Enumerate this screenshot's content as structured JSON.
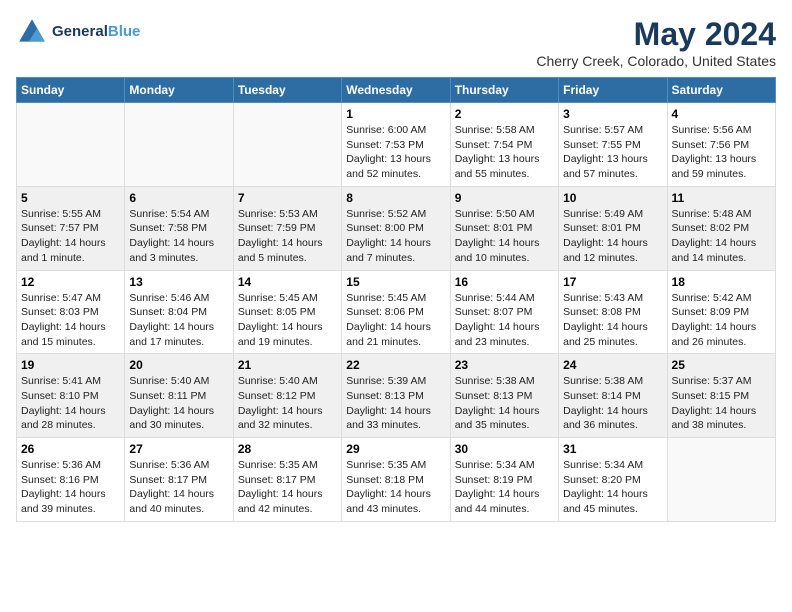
{
  "header": {
    "logo_line1": "General",
    "logo_line2": "Blue",
    "title": "May 2024",
    "subtitle": "Cherry Creek, Colorado, United States"
  },
  "weekdays": [
    "Sunday",
    "Monday",
    "Tuesday",
    "Wednesday",
    "Thursday",
    "Friday",
    "Saturday"
  ],
  "weeks": [
    [
      {
        "day": "",
        "info": ""
      },
      {
        "day": "",
        "info": ""
      },
      {
        "day": "",
        "info": ""
      },
      {
        "day": "1",
        "info": "Sunrise: 6:00 AM\nSunset: 7:53 PM\nDaylight: 13 hours\nand 52 minutes."
      },
      {
        "day": "2",
        "info": "Sunrise: 5:58 AM\nSunset: 7:54 PM\nDaylight: 13 hours\nand 55 minutes."
      },
      {
        "day": "3",
        "info": "Sunrise: 5:57 AM\nSunset: 7:55 PM\nDaylight: 13 hours\nand 57 minutes."
      },
      {
        "day": "4",
        "info": "Sunrise: 5:56 AM\nSunset: 7:56 PM\nDaylight: 13 hours\nand 59 minutes."
      }
    ],
    [
      {
        "day": "5",
        "info": "Sunrise: 5:55 AM\nSunset: 7:57 PM\nDaylight: 14 hours\nand 1 minute."
      },
      {
        "day": "6",
        "info": "Sunrise: 5:54 AM\nSunset: 7:58 PM\nDaylight: 14 hours\nand 3 minutes."
      },
      {
        "day": "7",
        "info": "Sunrise: 5:53 AM\nSunset: 7:59 PM\nDaylight: 14 hours\nand 5 minutes."
      },
      {
        "day": "8",
        "info": "Sunrise: 5:52 AM\nSunset: 8:00 PM\nDaylight: 14 hours\nand 7 minutes."
      },
      {
        "day": "9",
        "info": "Sunrise: 5:50 AM\nSunset: 8:01 PM\nDaylight: 14 hours\nand 10 minutes."
      },
      {
        "day": "10",
        "info": "Sunrise: 5:49 AM\nSunset: 8:01 PM\nDaylight: 14 hours\nand 12 minutes."
      },
      {
        "day": "11",
        "info": "Sunrise: 5:48 AM\nSunset: 8:02 PM\nDaylight: 14 hours\nand 14 minutes."
      }
    ],
    [
      {
        "day": "12",
        "info": "Sunrise: 5:47 AM\nSunset: 8:03 PM\nDaylight: 14 hours\nand 15 minutes."
      },
      {
        "day": "13",
        "info": "Sunrise: 5:46 AM\nSunset: 8:04 PM\nDaylight: 14 hours\nand 17 minutes."
      },
      {
        "day": "14",
        "info": "Sunrise: 5:45 AM\nSunset: 8:05 PM\nDaylight: 14 hours\nand 19 minutes."
      },
      {
        "day": "15",
        "info": "Sunrise: 5:45 AM\nSunset: 8:06 PM\nDaylight: 14 hours\nand 21 minutes."
      },
      {
        "day": "16",
        "info": "Sunrise: 5:44 AM\nSunset: 8:07 PM\nDaylight: 14 hours\nand 23 minutes."
      },
      {
        "day": "17",
        "info": "Sunrise: 5:43 AM\nSunset: 8:08 PM\nDaylight: 14 hours\nand 25 minutes."
      },
      {
        "day": "18",
        "info": "Sunrise: 5:42 AM\nSunset: 8:09 PM\nDaylight: 14 hours\nand 26 minutes."
      }
    ],
    [
      {
        "day": "19",
        "info": "Sunrise: 5:41 AM\nSunset: 8:10 PM\nDaylight: 14 hours\nand 28 minutes."
      },
      {
        "day": "20",
        "info": "Sunrise: 5:40 AM\nSunset: 8:11 PM\nDaylight: 14 hours\nand 30 minutes."
      },
      {
        "day": "21",
        "info": "Sunrise: 5:40 AM\nSunset: 8:12 PM\nDaylight: 14 hours\nand 32 minutes."
      },
      {
        "day": "22",
        "info": "Sunrise: 5:39 AM\nSunset: 8:13 PM\nDaylight: 14 hours\nand 33 minutes."
      },
      {
        "day": "23",
        "info": "Sunrise: 5:38 AM\nSunset: 8:13 PM\nDaylight: 14 hours\nand 35 minutes."
      },
      {
        "day": "24",
        "info": "Sunrise: 5:38 AM\nSunset: 8:14 PM\nDaylight: 14 hours\nand 36 minutes."
      },
      {
        "day": "25",
        "info": "Sunrise: 5:37 AM\nSunset: 8:15 PM\nDaylight: 14 hours\nand 38 minutes."
      }
    ],
    [
      {
        "day": "26",
        "info": "Sunrise: 5:36 AM\nSunset: 8:16 PM\nDaylight: 14 hours\nand 39 minutes."
      },
      {
        "day": "27",
        "info": "Sunrise: 5:36 AM\nSunset: 8:17 PM\nDaylight: 14 hours\nand 40 minutes."
      },
      {
        "day": "28",
        "info": "Sunrise: 5:35 AM\nSunset: 8:17 PM\nDaylight: 14 hours\nand 42 minutes."
      },
      {
        "day": "29",
        "info": "Sunrise: 5:35 AM\nSunset: 8:18 PM\nDaylight: 14 hours\nand 43 minutes."
      },
      {
        "day": "30",
        "info": "Sunrise: 5:34 AM\nSunset: 8:19 PM\nDaylight: 14 hours\nand 44 minutes."
      },
      {
        "day": "31",
        "info": "Sunrise: 5:34 AM\nSunset: 8:20 PM\nDaylight: 14 hours\nand 45 minutes."
      },
      {
        "day": "",
        "info": ""
      }
    ]
  ]
}
